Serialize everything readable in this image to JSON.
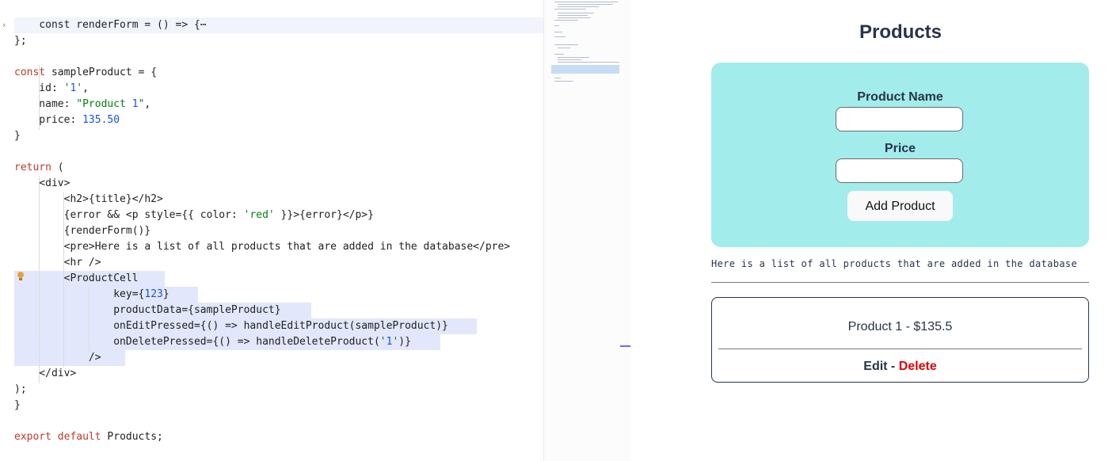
{
  "editor": {
    "lines": [
      "const renderForm = () => {⋯",
      "};",
      "",
      "const sampleProduct = {",
      "    id: '1',",
      "    name: \"Product 1\",",
      "    price: 135.50",
      "}",
      "",
      "return (",
      "    <div>",
      "        <h2>{title}</h2>",
      "        {error && <p style={{ color: 'red' }}>{error}</p>}",
      "        {renderForm()}",
      "        <pre>Here is a list of all products that are added in the database</pre>",
      "        <hr />",
      "        <ProductCell",
      "                key={123}",
      "                productData={sampleProduct}",
      "                onEditPressed={() => handleEditProduct(sampleProduct)}",
      "                onDeletePressed={() => handleDeleteProduct('1')}",
      "            />",
      "    </div>",
      ");",
      "}",
      "",
      "export default Products;"
    ]
  },
  "app": {
    "title": "Products",
    "form": {
      "name_label": "Product Name",
      "price_label": "Price",
      "name_value": "",
      "price_value": "",
      "submit_label": "Add Product"
    },
    "info_text": "Here is a list of all products that are added in the database",
    "product_cell": {
      "text": "Product 1 - $135.5",
      "edit_label": "Edit",
      "separator": " - ",
      "delete_label": "Delete"
    }
  },
  "colors": {
    "form_bg": "#a3ecec",
    "text_dark": "#273449",
    "delete_red": "#e00000",
    "selection": "#e2e7fb"
  }
}
